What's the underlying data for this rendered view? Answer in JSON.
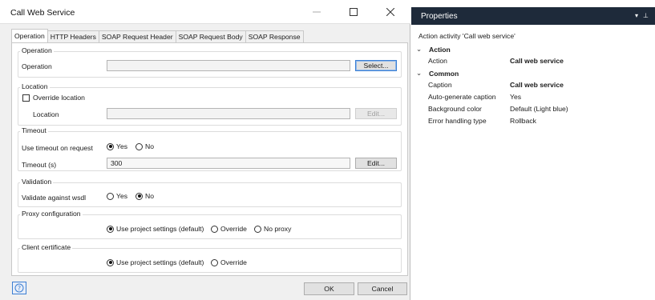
{
  "dialog": {
    "title": "Call Web Service",
    "tabs": [
      "Operation",
      "HTTP Headers",
      "SOAP Request Header",
      "SOAP Request Body",
      "SOAP Response"
    ],
    "operation": {
      "group_title": "Operation",
      "label": "Operation",
      "value": "",
      "select_button": "Select..."
    },
    "location": {
      "group_title": "Location",
      "override_label": "Override location",
      "override_checked": false,
      "label": "Location",
      "value": "",
      "edit_button": "Edit..."
    },
    "timeout": {
      "group_title": "Timeout",
      "use_label": "Use timeout on request",
      "yes": "Yes",
      "no": "No",
      "selected": "Yes",
      "timeout_label": "Timeout (s)",
      "timeout_value": "300",
      "edit_button": "Edit..."
    },
    "validation": {
      "group_title": "Validation",
      "label": "Validate against wsdl",
      "yes": "Yes",
      "no": "No",
      "selected": "No"
    },
    "proxy": {
      "group_title": "Proxy configuration",
      "opt_project": "Use project settings (default)",
      "opt_override": "Override",
      "opt_noproxy": "No proxy",
      "selected": "Use project settings (default)"
    },
    "certificate": {
      "group_title": "Client certificate",
      "opt_project": "Use project settings (default)",
      "opt_override": "Override",
      "selected": "Use project settings (default)"
    },
    "footer": {
      "ok": "OK",
      "cancel": "Cancel"
    }
  },
  "properties": {
    "title": "Properties",
    "subtitle": "Action activity 'Call web service'",
    "categories": [
      {
        "name": "Action",
        "rows": [
          {
            "label": "Action",
            "value": "Call web service",
            "bold": true
          }
        ]
      },
      {
        "name": "Common",
        "rows": [
          {
            "label": "Caption",
            "value": "Call web service",
            "bold": true
          },
          {
            "label": "Auto-generate caption",
            "value": "Yes",
            "bold": false
          },
          {
            "label": "Background color",
            "value": "Default (Light blue)",
            "bold": false
          },
          {
            "label": "Error handling type",
            "value": "Rollback",
            "bold": false
          }
        ]
      }
    ]
  },
  "colors": {
    "accent": "#3c7fd3",
    "props_header": "#1e2a3a"
  }
}
